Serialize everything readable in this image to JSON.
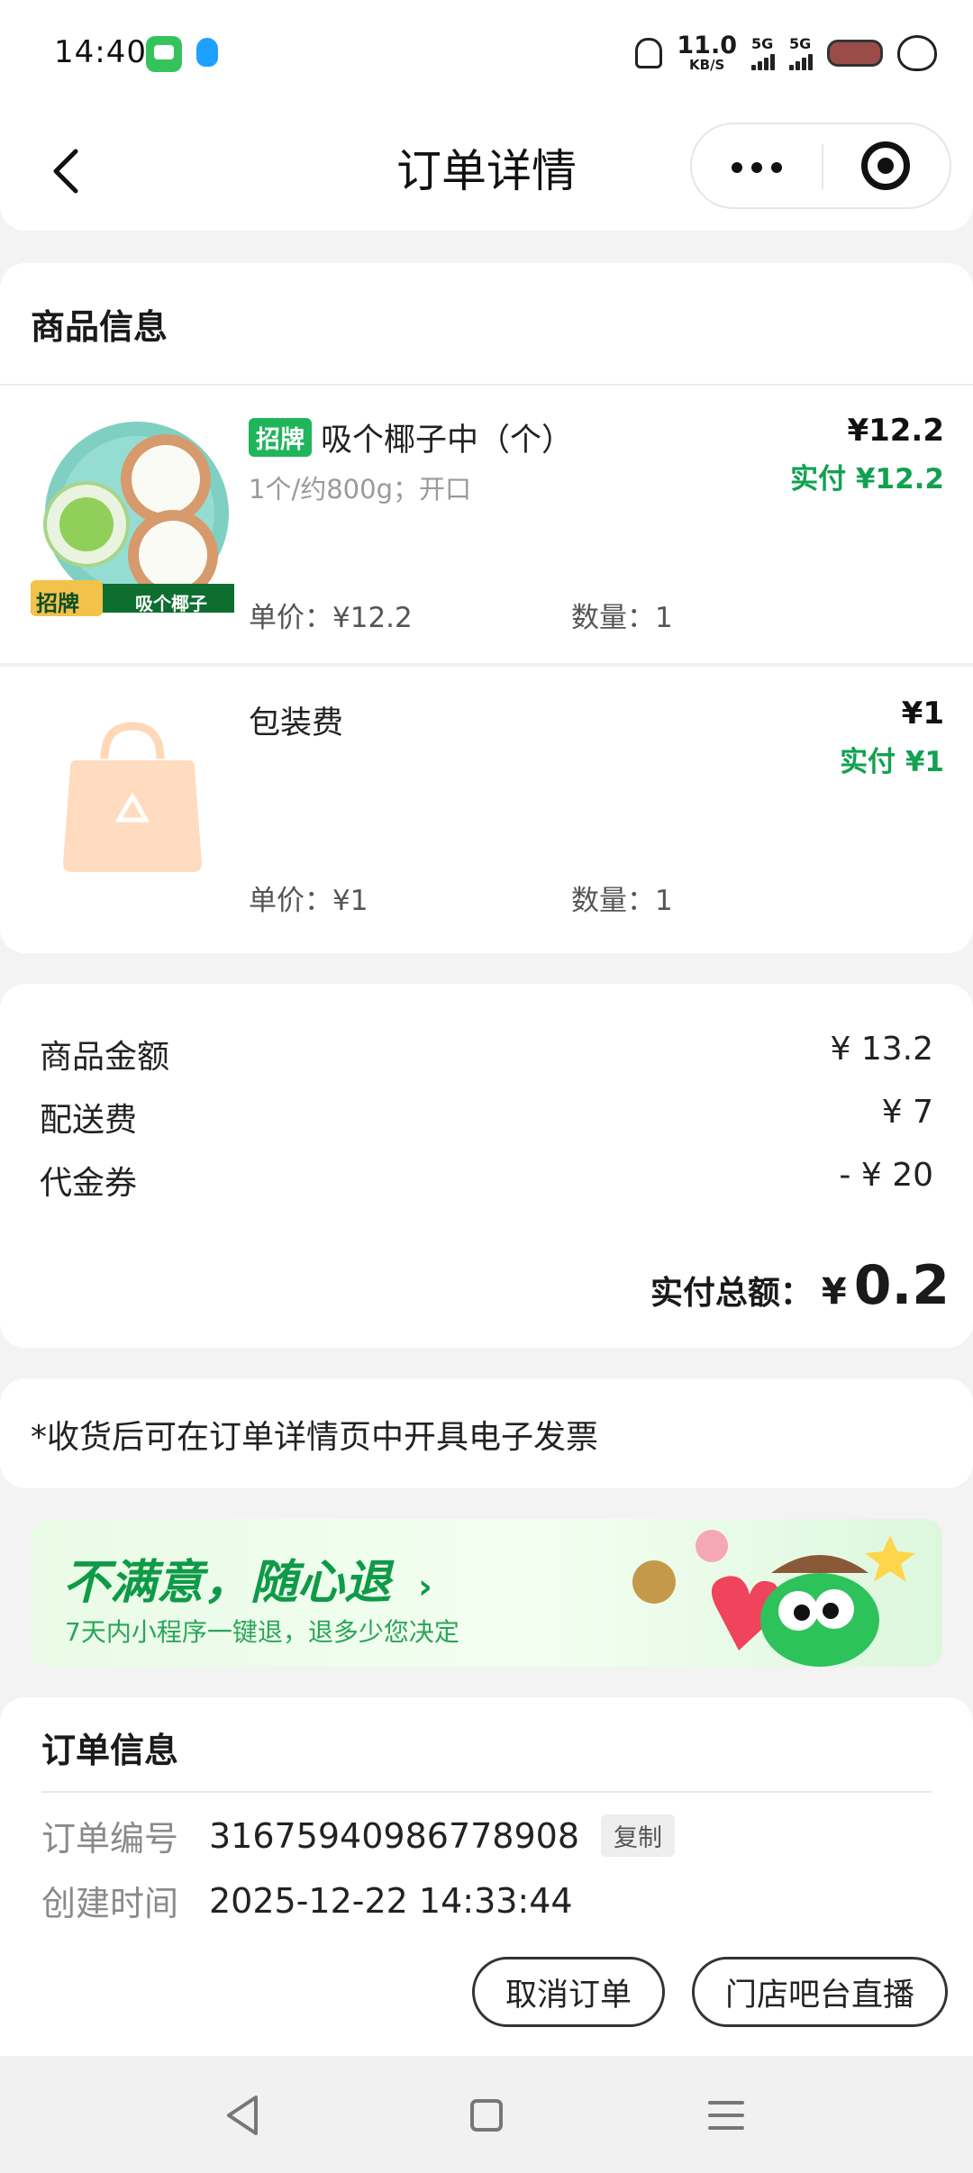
{
  "status_bar": {
    "time": "14:40",
    "speed_value": "11.0",
    "speed_unit": "KB/S",
    "signal1_label": "5G",
    "signal2_label": "5G"
  },
  "nav": {
    "title": "订单详情"
  },
  "goods": {
    "header": "商品信息",
    "items": [
      {
        "tag": "招牌",
        "name": "吸个椰子中（个）",
        "spec": "1个/约800g；开口",
        "price": "¥12.2",
        "paid": "实付 ¥12.2",
        "unit_price": "单价：¥12.2",
        "quantity": "数量：1",
        "thumb_caption": "吸个椰子",
        "thumb_badge": "招牌"
      },
      {
        "name": "包装费",
        "price": "¥1",
        "paid": "实付 ¥1",
        "unit_price": "单价：¥1",
        "quantity": "数量：1"
      }
    ]
  },
  "summary": {
    "rows": [
      {
        "label": "商品金额",
        "value": "¥ 13.2"
      },
      {
        "label": "配送费",
        "value": "¥ 7"
      },
      {
        "label": "代金券",
        "value": "- ¥ 20"
      }
    ],
    "total_label": "实付总额：",
    "total_currency": "¥",
    "total_amount": "0.2"
  },
  "invoice_note": "*收货后可在订单详情页中开具电子发票",
  "banner": {
    "title": "不满意，随心退",
    "subtitle": "7天内小程序一键退，退多少您决定"
  },
  "order_info": {
    "header": "订单信息",
    "number_label": "订单编号",
    "number_value": "31675940986778908",
    "copy_label": "复制",
    "created_label": "创建时间",
    "created_value": "2025-12-22 14:33:44"
  },
  "actions": {
    "cancel": "取消订单",
    "live": "门店吧台直播"
  },
  "colors": {
    "accent_green": "#12a150",
    "tag_green": "#1fb55a"
  }
}
